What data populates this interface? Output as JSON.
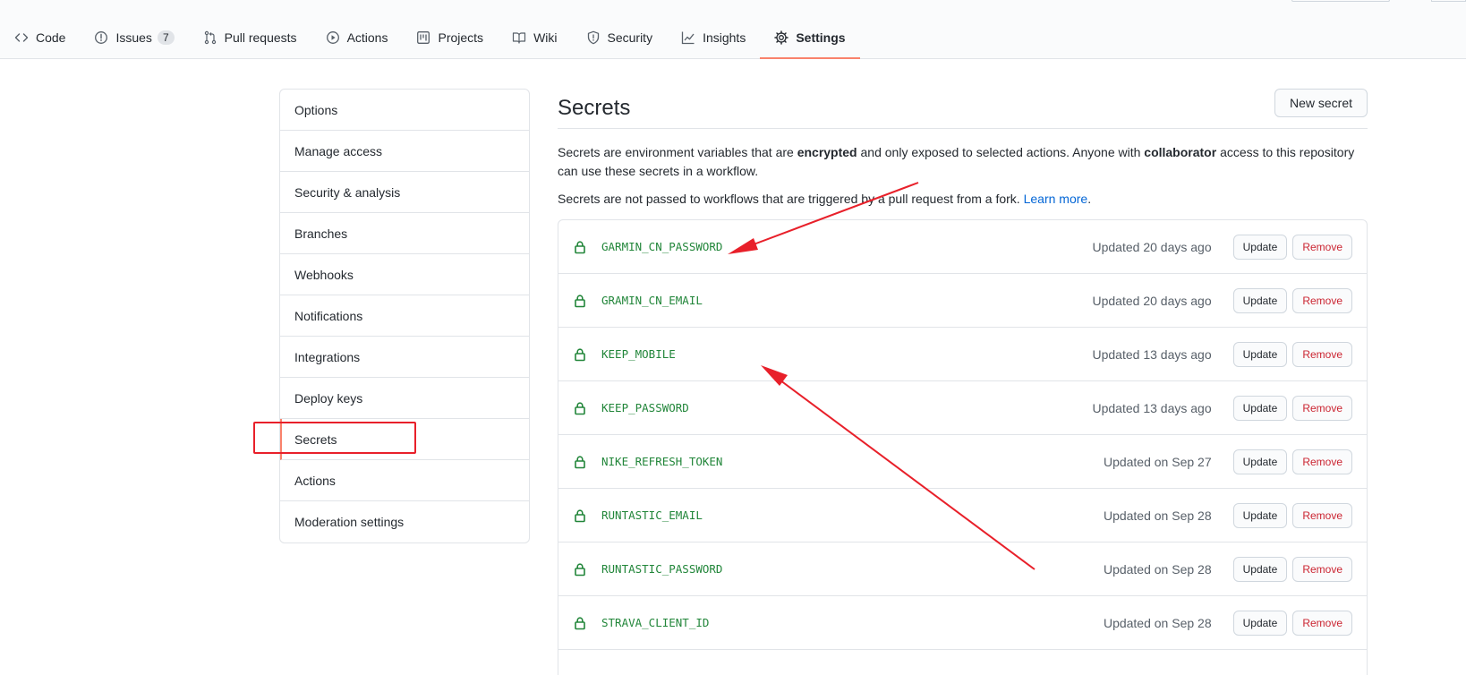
{
  "nav": {
    "tabs": [
      {
        "label": "Code",
        "icon": "code-icon"
      },
      {
        "label": "Issues",
        "icon": "issue-icon",
        "count": "7"
      },
      {
        "label": "Pull requests",
        "icon": "pull-request-icon"
      },
      {
        "label": "Actions",
        "icon": "play-icon"
      },
      {
        "label": "Projects",
        "icon": "project-icon"
      },
      {
        "label": "Wiki",
        "icon": "book-icon"
      },
      {
        "label": "Security",
        "icon": "shield-icon"
      },
      {
        "label": "Insights",
        "icon": "graph-icon"
      },
      {
        "label": "Settings",
        "icon": "gear-icon"
      }
    ],
    "selected": "Settings"
  },
  "sidebar": {
    "items": [
      {
        "label": "Options"
      },
      {
        "label": "Manage access"
      },
      {
        "label": "Security & analysis"
      },
      {
        "label": "Branches"
      },
      {
        "label": "Webhooks"
      },
      {
        "label": "Notifications"
      },
      {
        "label": "Integrations"
      },
      {
        "label": "Deploy keys"
      },
      {
        "label": "Secrets"
      },
      {
        "label": "Actions"
      },
      {
        "label": "Moderation settings"
      }
    ],
    "selected": "Secrets"
  },
  "main": {
    "title": "Secrets",
    "new_secret_label": "New secret",
    "description": {
      "part1": "Secrets are environment variables that are ",
      "bold1": "encrypted",
      "part2": " and only exposed to selected actions. Anyone with ",
      "bold2": "collaborator",
      "part3": " access to this repository can use these secrets in a workflow."
    },
    "fork_note": "Secrets are not passed to workflows that are triggered by a pull request from a fork.",
    "learn_more": "Learn more",
    "learn_more_suffix": ".",
    "update_label": "Update",
    "remove_label": "Remove",
    "secrets": [
      {
        "name": "GARMIN_CN_PASSWORD",
        "updated": "Updated 20 days ago"
      },
      {
        "name": "GRAMIN_CN_EMAIL",
        "updated": "Updated 20 days ago"
      },
      {
        "name": "KEEP_MOBILE",
        "updated": "Updated 13 days ago"
      },
      {
        "name": "KEEP_PASSWORD",
        "updated": "Updated 13 days ago"
      },
      {
        "name": "NIKE_REFRESH_TOKEN",
        "updated": "Updated on Sep 27"
      },
      {
        "name": "RUNTASTIC_EMAIL",
        "updated": "Updated on Sep 28"
      },
      {
        "name": "RUNTASTIC_PASSWORD",
        "updated": "Updated on Sep 28"
      },
      {
        "name": "STRAVA_CLIENT_ID",
        "updated": "Updated on Sep 28"
      }
    ]
  },
  "colors": {
    "accent_underline": "#f9826c",
    "secret_name": "#22863a",
    "remove": "#cb2431",
    "link": "#0366d6",
    "annotation": "#e8202a"
  }
}
